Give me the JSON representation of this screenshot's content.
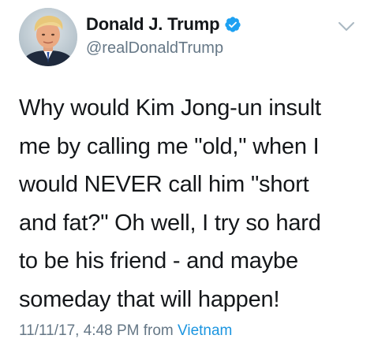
{
  "author": {
    "display_name": "Donald J. Trump",
    "handle": "@realDonaldTrump",
    "verified": true,
    "avatar_icon": "profile-photo",
    "verified_icon": "verified-badge-icon",
    "menu_icon": "chevron-down-icon"
  },
  "tweet": {
    "lines": [
      "Why would Kim Jong-un insult",
      "me by calling me \"old,\" when I",
      "would NEVER call him \"short",
      "and fat?\" Oh well, I try so hard",
      "to be his friend - and maybe",
      "someday that will happen!"
    ]
  },
  "meta": {
    "timestamp": "11/11/17, 4:48 PM",
    "from_label": "from",
    "location": "Vietnam"
  },
  "colors": {
    "text": "#14171a",
    "secondary": "#657786",
    "link": "#1b95e0",
    "verified": "#1da1f2"
  }
}
